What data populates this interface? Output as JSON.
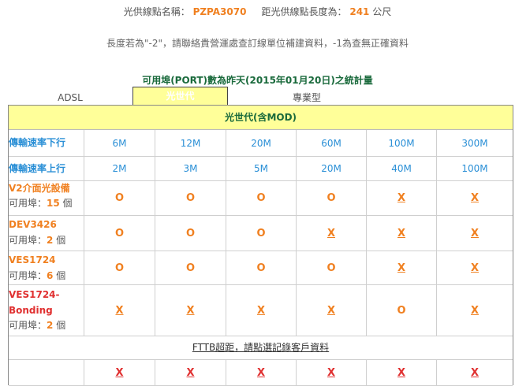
{
  "header": {
    "site_name_label": "光供線點名稱：",
    "site_code": "PZPA3070",
    "distance_label": "距光供線點長度為：",
    "distance_value": "241",
    "distance_unit": "公尺",
    "note": "長度若為\"-2\"，請聯絡貴營運處查訂線單位補建資料，-1為查無正確資料",
    "stats_title": "可用埠(PORT)數為昨天(2015年01月20日)之統計量"
  },
  "tabs": [
    {
      "label": "ADSL"
    },
    {
      "label": "光世代"
    },
    {
      "label": "專業型"
    }
  ],
  "banner": "光世代(含MOD)",
  "speed_rows": [
    {
      "label": "傳輸速率下行",
      "values": [
        "6M",
        "12M",
        "20M",
        "60M",
        "100M",
        "300M"
      ]
    },
    {
      "label": "傳輸速率上行",
      "values": [
        "2M",
        "3M",
        "5M",
        "20M",
        "40M",
        "100M"
      ]
    }
  ],
  "avail_prefix": "可用埠：",
  "avail_suffix": "個",
  "devices": [
    {
      "name": "V2介面光設備",
      "ports": "15",
      "marks": [
        "O",
        "O",
        "O",
        "O",
        "X",
        "X"
      ]
    },
    {
      "name": "DEV3426",
      "ports": "2",
      "marks": [
        "O",
        "O",
        "O",
        "X",
        "X",
        "X"
      ]
    },
    {
      "name": "VES1724",
      "ports": "6",
      "marks": [
        "O",
        "O",
        "O",
        "O",
        "X",
        "X"
      ]
    },
    {
      "name_line1": "VES1724-",
      "name_line2": "Bonding",
      "ports": "2",
      "marks": [
        "X",
        "X",
        "X",
        "X",
        "O",
        "X"
      ]
    }
  ],
  "fttb_text": "FTTB超距，請點選記錄客戶資料",
  "last_row_marks": [
    "X",
    "X",
    "X",
    "X",
    "X",
    "X"
  ],
  "colors": {
    "accent_orange": "#f08020",
    "speed_blue": "#2a8fd6",
    "heading_green": "#1a6a3c",
    "banner_yellow": "#ffff99",
    "red": "#e03030"
  }
}
